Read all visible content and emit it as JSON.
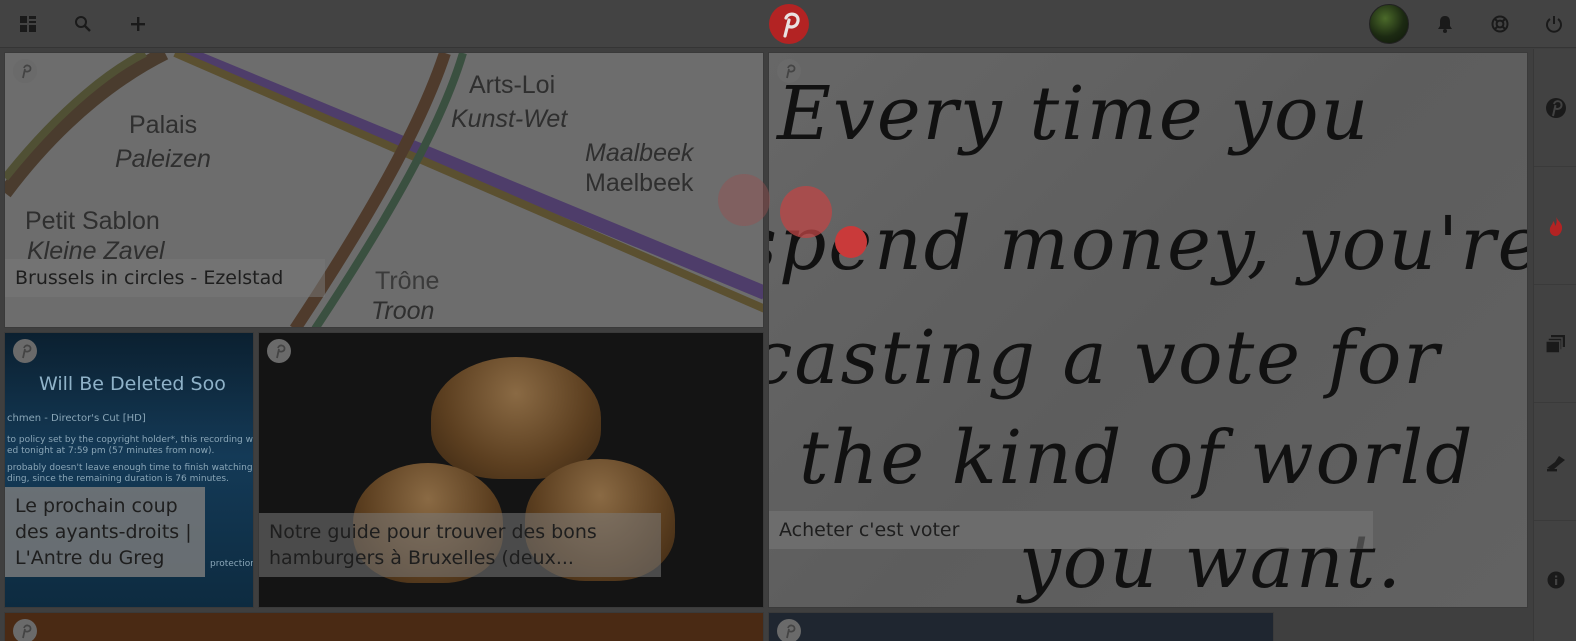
{
  "topbar": {
    "left_icons": [
      "grid-icon",
      "search-icon",
      "plus-icon"
    ],
    "right_icons": [
      "bell-icon",
      "lifebuoy-icon",
      "power-icon"
    ]
  },
  "rail": {
    "icons": [
      "pinterest-icon",
      "flame-icon",
      "boards-icon",
      "pin-tool-icon",
      "info-icon"
    ]
  },
  "cards": {
    "map": {
      "caption": "Brussels in circles - Ezelstad",
      "labels": [
        "Palais",
        "Paleizen",
        "Petit Sablon",
        "Kleine Zavel",
        "Arts-Loi",
        "Kunst-Wet",
        "Maalbeek",
        "Maelbeek",
        "Trône",
        "Troon"
      ]
    },
    "video": {
      "caption": "Le prochain coup des ayants-droits | L'Antre du Greg",
      "title_text": "Will Be Deleted Soo",
      "subtitle": "chmen - Director's Cut [HD]",
      "lines": [
        "to policy set by the copyright holder*, this recording will be",
        "ed tonight at 7:59 pm (57 minutes from now).",
        "probably doesn't leave enough time to finish watching the",
        "ding, since the remaining duration is 76 minutes.",
        "protection."
      ]
    },
    "burger": {
      "caption": "Notre guide pour trouver des bons hamburgers à Bruxelles (deux..."
    },
    "note": {
      "caption": "Acheter c'est voter",
      "lines": [
        "Every time you",
        "spend money, you're",
        "casting a vote for",
        "the kind of world",
        "you want."
      ]
    }
  },
  "colors": {
    "brand": "#b32323",
    "overlay": "#3f3f3f"
  }
}
